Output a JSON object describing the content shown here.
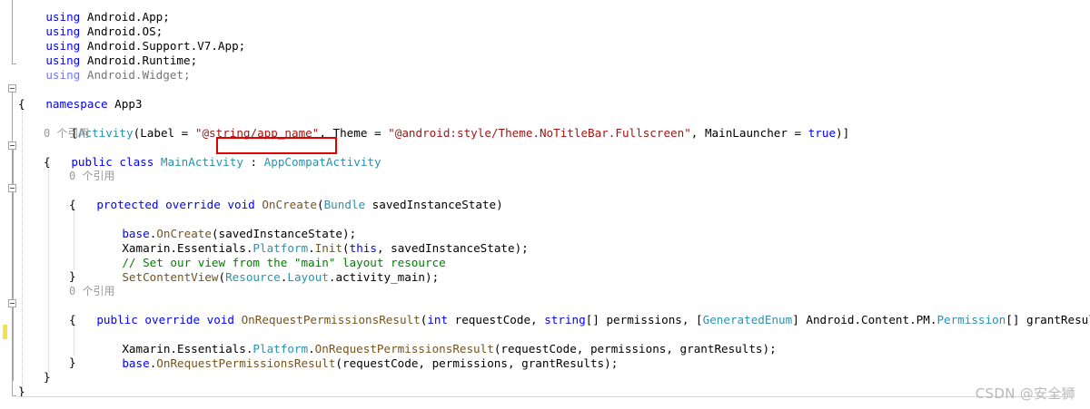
{
  "usings": [
    {
      "kw": "using",
      "ns": "Android.App;"
    },
    {
      "kw": "using",
      "ns": "Android.OS;"
    },
    {
      "kw": "using",
      "ns": "Android.Support.V7.App;"
    },
    {
      "kw": "using",
      "ns": "Android.Runtime;"
    },
    {
      "kw": "using",
      "ns": "Android.Widget;"
    }
  ],
  "namespace": {
    "kw": "namespace",
    "name": " App3"
  },
  "brace_open": "{",
  "brace_close": "}",
  "attribute": {
    "open": "[",
    "name": "Activity",
    "p1": "(Label = ",
    "label_value": "\"@string/app_name\"",
    "p2": ", Theme = ",
    "theme_value": "\"@android:style/Theme.NoTitleBar.Fullscreen\"",
    "p3": ", MainLauncher = ",
    "true_kw": "true",
    "close": ")]"
  },
  "ref_count": "0 个引用",
  "class_decl": {
    "kw": "public class",
    "name": " MainActivity",
    "colon": " : ",
    "base": "AppCompatActivity"
  },
  "oncreate": {
    "kw": "protected override void",
    "name": " OnCreate",
    "paren": "(",
    "ptype": "Bundle",
    "pname": " savedInstanceState)",
    "body": {
      "l1_base": "base",
      "l1_dot": ".",
      "l1_fn": "OnCreate",
      "l1_args": "(savedInstanceState);",
      "l2_pre": "Xamarin.Essentials.",
      "l2_type": "Platform",
      "l2_dot": ".",
      "l2_fn": "Init",
      "l2_paren": "(",
      "l2_this": "this",
      "l2_args": ", savedInstanceState);",
      "l3_comment": "// Set our view from the \"main\" layout resource",
      "l4_fn": "SetContentView",
      "l4_paren": "(",
      "l4_t1": "Resource",
      "l4_dot": ".",
      "l4_t2": "Layout",
      "l4_args": ".activity_main);"
    }
  },
  "onperm": {
    "kw": "public override void",
    "name": " OnRequestPermissionsResult",
    "p_open": "(",
    "int_kw": "int",
    "p1": " requestCode, ",
    "string_kw": "string",
    "p2": "[] permissions, [",
    "gen_enum": "GeneratedEnum",
    "p3": "] Android.Content.PM.",
    "perm_type": "Permission",
    "p4": "[] grantResults)",
    "body": {
      "l1_pre": "Xamarin.Essentials.",
      "l1_type": "Platform",
      "l1_dot": ".",
      "l1_fn": "OnRequestPermissionsResult",
      "l1_args": "(requestCode, permissions, grantResults);",
      "l2_base": "base",
      "l2_dot": ".",
      "l2_fn": "OnRequestPermissionsResult",
      "l2_args": "(requestCode, permissions, grantResults);"
    }
  },
  "watermark": "CSDN @安全狮"
}
